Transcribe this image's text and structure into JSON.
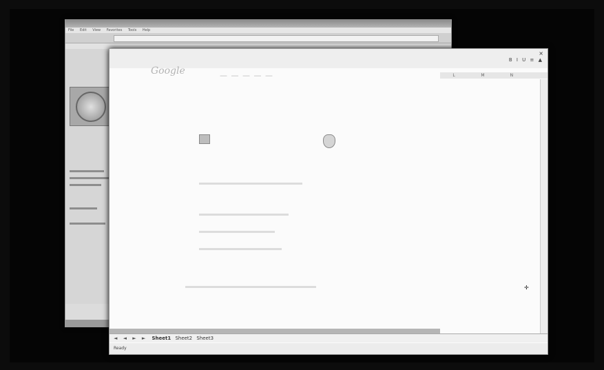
{
  "browser": {
    "menu": [
      "File",
      "Edit",
      "View",
      "Favorites",
      "Tools",
      "Help"
    ]
  },
  "spreadsheet": {
    "close_label": "×",
    "columns": [
      "L",
      "M",
      "N"
    ],
    "sheet_tabs": [
      "Sheet1",
      "Sheet2",
      "Sheet3"
    ],
    "nav_arrows": "◄ ◄ ► ►",
    "status": "Ready"
  },
  "page": {
    "logo": "Google"
  },
  "colors": {
    "progress_bar": "#c62828",
    "background": "#050505"
  }
}
